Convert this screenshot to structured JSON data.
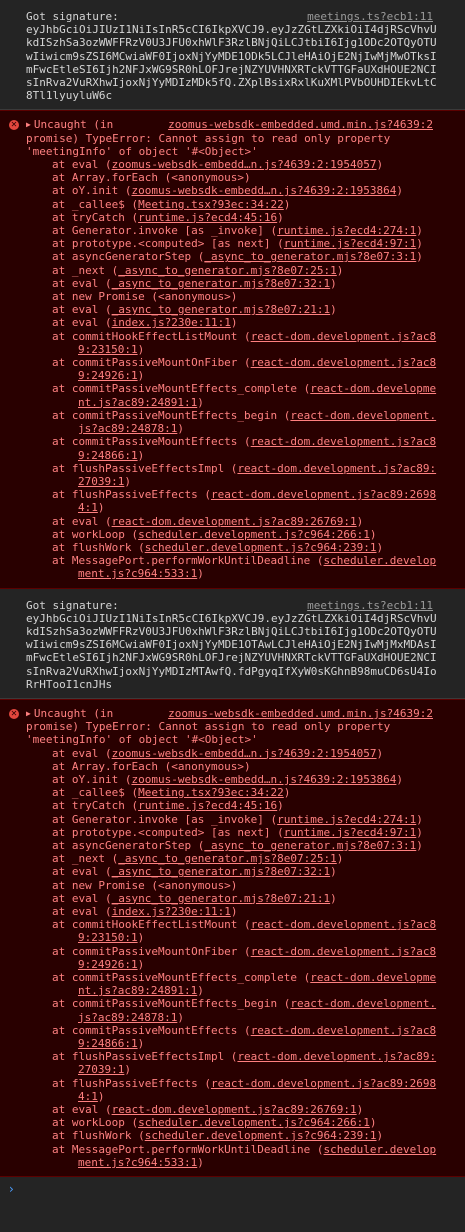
{
  "entries": [
    {
      "kind": "log",
      "text": "Got signature:",
      "source": "meetings.ts?ecb1:11",
      "body": "eyJhbGciOiJIUzI1NiIsInR5cCI6IkpXVCJ9.eyJzZGtLZXkiOiI4djRScVhvUkdISzhSa3ozWWFFRzV0U3JFU0xhWlF3RzlBNjQiLCJtbiI6Ijg1ODc2OTQyOTUwIiwicm9sZSI6MCwiaWF0IjoxNjYyMDE1ODk5LCJleHAiOjE2NjIwMjMwOTksImFwcEtleSI6Ijh2NFJxWG9SR0hLOFJrejNZYUVHNXRTckVTTGFaUXdHOUE2NCIsInRva2VuRXhwIjoxNjYyMDIzMDk5fQ.ZXplBsixRxlKuXMlPVbOUHDIEkvLtC8Tl1lyuyluW6c"
    },
    {
      "kind": "error",
      "head": "Uncaught (in",
      "source": "zoomus-websdk-embedded.umd.min.js?4639:2",
      "message": "promise) TypeError: Cannot assign to read only property 'meetingInfo' of object '#<Object>'",
      "frames": [
        {
          "pre": "at eval (",
          "link": "zoomus-websdk-embedd…n.js?4639:2:1954057",
          "post": ")"
        },
        {
          "pre": "at Array.forEach (<anonymous>)",
          "link": "",
          "post": ""
        },
        {
          "pre": "at oY.init (",
          "link": "zoomus-websdk-embedd…n.js?4639:2:1953864",
          "post": ")"
        },
        {
          "pre": "at _callee$ (",
          "link": "Meeting.tsx?93ec:34:22",
          "post": ")"
        },
        {
          "pre": "at tryCatch (",
          "link": "runtime.js?ecd4:45:16",
          "post": ")"
        },
        {
          "pre": "at Generator.invoke [as _invoke] (",
          "link": "runtime.js?ecd4:274:1",
          "post": ")"
        },
        {
          "pre": "at prototype.<computed> [as next] (",
          "link": "runtime.js?ecd4:97:1",
          "post": ")"
        },
        {
          "pre": "at asyncGeneratorStep (",
          "link": "_async_to_generator.mjs?8e07:3:1",
          "post": ")"
        },
        {
          "pre": "at _next (",
          "link": "_async_to_generator.mjs?8e07:25:1",
          "post": ")"
        },
        {
          "pre": "at eval (",
          "link": "_async_to_generator.mjs?8e07:32:1",
          "post": ")"
        },
        {
          "pre": "at new Promise (<anonymous>)",
          "link": "",
          "post": ""
        },
        {
          "pre": "at eval (",
          "link": "_async_to_generator.mjs?8e07:21:1",
          "post": ")"
        },
        {
          "pre": "at eval (",
          "link": "index.js?230e:11:1",
          "post": ")"
        },
        {
          "pre": "at commitHookEffectListMount (",
          "link": "react-dom.development.js?ac89:23150:1",
          "post": ")"
        },
        {
          "pre": "at commitPassiveMountOnFiber (",
          "link": "react-dom.development.js?ac89:24926:1",
          "post": ")"
        },
        {
          "pre": "at commitPassiveMountEffects_complete (",
          "link": "react-dom.development.js?ac89:24891:1",
          "post": ")"
        },
        {
          "pre": "at commitPassiveMountEffects_begin (",
          "link": "react-dom.development.js?ac89:24878:1",
          "post": ")"
        },
        {
          "pre": "at commitPassiveMountEffects (",
          "link": "react-dom.development.js?ac89:24866:1",
          "post": ")"
        },
        {
          "pre": "at flushPassiveEffectsImpl (",
          "link": "react-dom.development.js?ac89:27039:1",
          "post": ")"
        },
        {
          "pre": "at flushPassiveEffects (",
          "link": "react-dom.development.js?ac89:26984:1",
          "post": ")"
        },
        {
          "pre": "at eval (",
          "link": "react-dom.development.js?ac89:26769:1",
          "post": ")"
        },
        {
          "pre": "at workLoop (",
          "link": "scheduler.development.js?c964:266:1",
          "post": ")"
        },
        {
          "pre": "at flushWork (",
          "link": "scheduler.development.js?c964:239:1",
          "post": ")"
        },
        {
          "pre": "at MessagePort.performWorkUntilDeadline (",
          "link": "scheduler.development.js?c964:533:1",
          "post": ")"
        }
      ]
    },
    {
      "kind": "log",
      "text": "Got signature:",
      "source": "meetings.ts?ecb1:11",
      "body": "eyJhbGciOiJIUzI1NiIsInR5cCI6IkpXVCJ9.eyJzZGtLZXkiOiI4djRScVhvUkdISzhSa3ozWWFFRzV0U3JFU0xhWlF3RzlBNjQiLCJtbiI6Ijg1ODc2OTQyOTUwIiwicm9sZSI6MCwiaWF0IjoxNjYyMDE1OTAwLCJleHAiOjE2NjIwMjMxMDAsImFwcEtleSI6Ijh2NFJxWG9SR0hLOFJrejNZYUVHNXRTckVTTGFaUXdHOUE2NCIsInRva2VuRXhwIjoxNjYyMDIzMTAwfQ.fdPgyqIfXyW0sKGhnB98muCD6sU4IoRrHTooI1cnJHs"
    },
    {
      "kind": "error",
      "head": "Uncaught (in",
      "source": "zoomus-websdk-embedded.umd.min.js?4639:2",
      "message": "promise) TypeError: Cannot assign to read only property 'meetingInfo' of object '#<Object>'",
      "frames": [
        {
          "pre": "at eval (",
          "link": "zoomus-websdk-embedd…n.js?4639:2:1954057",
          "post": ")"
        },
        {
          "pre": "at Array.forEach (<anonymous>)",
          "link": "",
          "post": ""
        },
        {
          "pre": "at oY.init (",
          "link": "zoomus-websdk-embedd…n.js?4639:2:1953864",
          "post": ")"
        },
        {
          "pre": "at _callee$ (",
          "link": "Meeting.tsx?93ec:34:22",
          "post": ")"
        },
        {
          "pre": "at tryCatch (",
          "link": "runtime.js?ecd4:45:16",
          "post": ")"
        },
        {
          "pre": "at Generator.invoke [as _invoke] (",
          "link": "runtime.js?ecd4:274:1",
          "post": ")"
        },
        {
          "pre": "at prototype.<computed> [as next] (",
          "link": "runtime.js?ecd4:97:1",
          "post": ")"
        },
        {
          "pre": "at asyncGeneratorStep (",
          "link": "_async_to_generator.mjs?8e07:3:1",
          "post": ")"
        },
        {
          "pre": "at _next (",
          "link": "_async_to_generator.mjs?8e07:25:1",
          "post": ")"
        },
        {
          "pre": "at eval (",
          "link": "_async_to_generator.mjs?8e07:32:1",
          "post": ")"
        },
        {
          "pre": "at new Promise (<anonymous>)",
          "link": "",
          "post": ""
        },
        {
          "pre": "at eval (",
          "link": "_async_to_generator.mjs?8e07:21:1",
          "post": ")"
        },
        {
          "pre": "at eval (",
          "link": "index.js?230e:11:1",
          "post": ")"
        },
        {
          "pre": "at commitHookEffectListMount (",
          "link": "react-dom.development.js?ac89:23150:1",
          "post": ")"
        },
        {
          "pre": "at commitPassiveMountOnFiber (",
          "link": "react-dom.development.js?ac89:24926:1",
          "post": ")"
        },
        {
          "pre": "at commitPassiveMountEffects_complete (",
          "link": "react-dom.development.js?ac89:24891:1",
          "post": ")"
        },
        {
          "pre": "at commitPassiveMountEffects_begin (",
          "link": "react-dom.development.js?ac89:24878:1",
          "post": ")"
        },
        {
          "pre": "at commitPassiveMountEffects (",
          "link": "react-dom.development.js?ac89:24866:1",
          "post": ")"
        },
        {
          "pre": "at flushPassiveEffectsImpl (",
          "link": "react-dom.development.js?ac89:27039:1",
          "post": ")"
        },
        {
          "pre": "at flushPassiveEffects (",
          "link": "react-dom.development.js?ac89:26984:1",
          "post": ")"
        },
        {
          "pre": "at eval (",
          "link": "react-dom.development.js?ac89:26769:1",
          "post": ")"
        },
        {
          "pre": "at workLoop (",
          "link": "scheduler.development.js?c964:266:1",
          "post": ")"
        },
        {
          "pre": "at flushWork (",
          "link": "scheduler.development.js?c964:239:1",
          "post": ")"
        },
        {
          "pre": "at MessagePort.performWorkUntilDeadline (",
          "link": "scheduler.development.js?c964:533:1",
          "post": ")"
        }
      ]
    }
  ],
  "prompt_symbol": "›",
  "icons": {
    "error": "error-circle-icon",
    "expand": "expand-triangle-icon"
  },
  "colors": {
    "background": "#242424",
    "error_bg": "#290000",
    "error_text": "#ff8080",
    "link": "#9a9a9a",
    "prompt": "#4d9fff"
  }
}
